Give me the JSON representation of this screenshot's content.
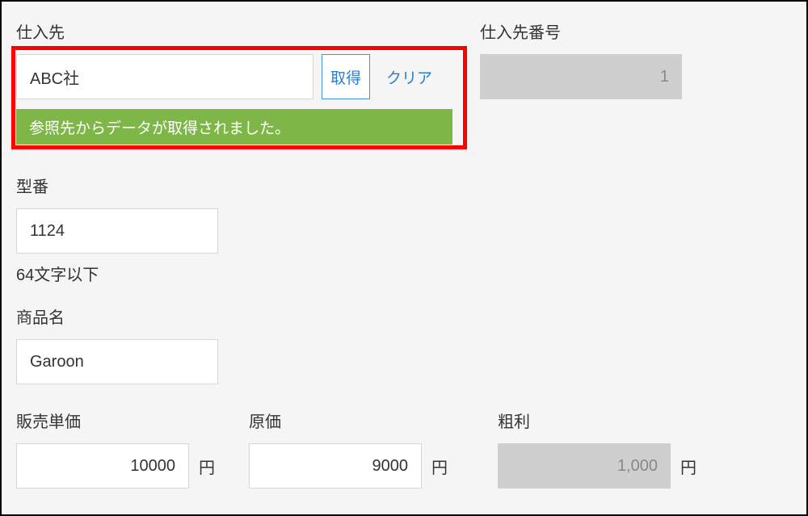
{
  "supplier": {
    "label": "仕入先",
    "value": "ABC社",
    "fetch_label": "取得",
    "clear_label": "クリア",
    "success_message": "参照先からデータが取得されました。"
  },
  "supplier_no": {
    "label": "仕入先番号",
    "value": "1"
  },
  "model_no": {
    "label": "型番",
    "value": "1124",
    "hint": "64文字以下"
  },
  "product_name": {
    "label": "商品名",
    "value": "Garoon"
  },
  "price": {
    "label": "販売単価",
    "value": "10000",
    "unit": "円"
  },
  "cost": {
    "label": "原価",
    "value": "9000",
    "unit": "円"
  },
  "margin": {
    "label": "粗利",
    "value": "1,000",
    "unit": "円"
  }
}
